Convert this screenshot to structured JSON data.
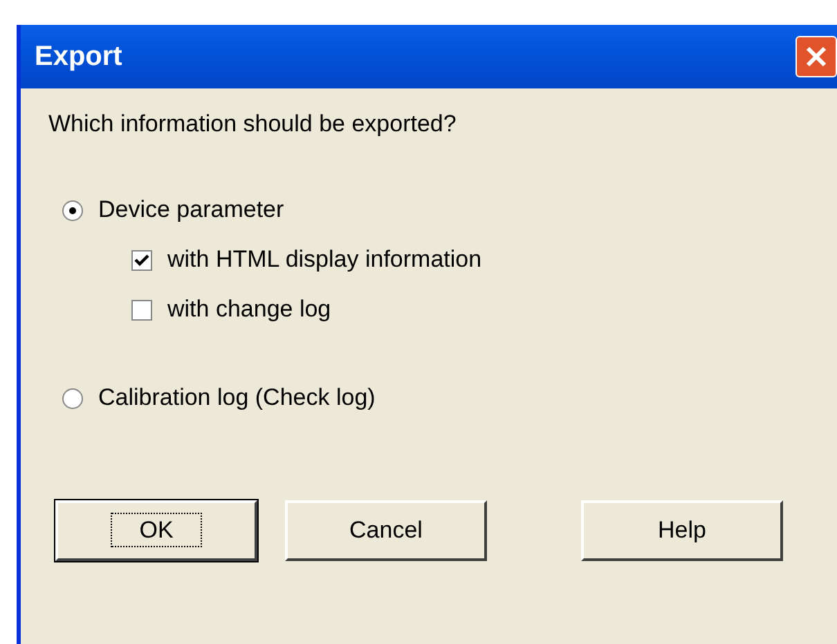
{
  "window": {
    "title": "Export"
  },
  "question": "Which information should be exported?",
  "options": [
    {
      "kind": "radio",
      "label": "Device parameter",
      "selected": true
    },
    {
      "kind": "checkbox",
      "label": "with HTML display information",
      "checked": true
    },
    {
      "kind": "checkbox",
      "label": "with change log",
      "checked": false
    },
    {
      "kind": "radio",
      "label": "Calibration log (Check log)",
      "selected": false
    }
  ],
  "buttons": [
    {
      "label": "OK",
      "focused": true
    },
    {
      "label": "Cancel",
      "focused": false
    },
    {
      "label": "Help",
      "focused": false
    }
  ]
}
